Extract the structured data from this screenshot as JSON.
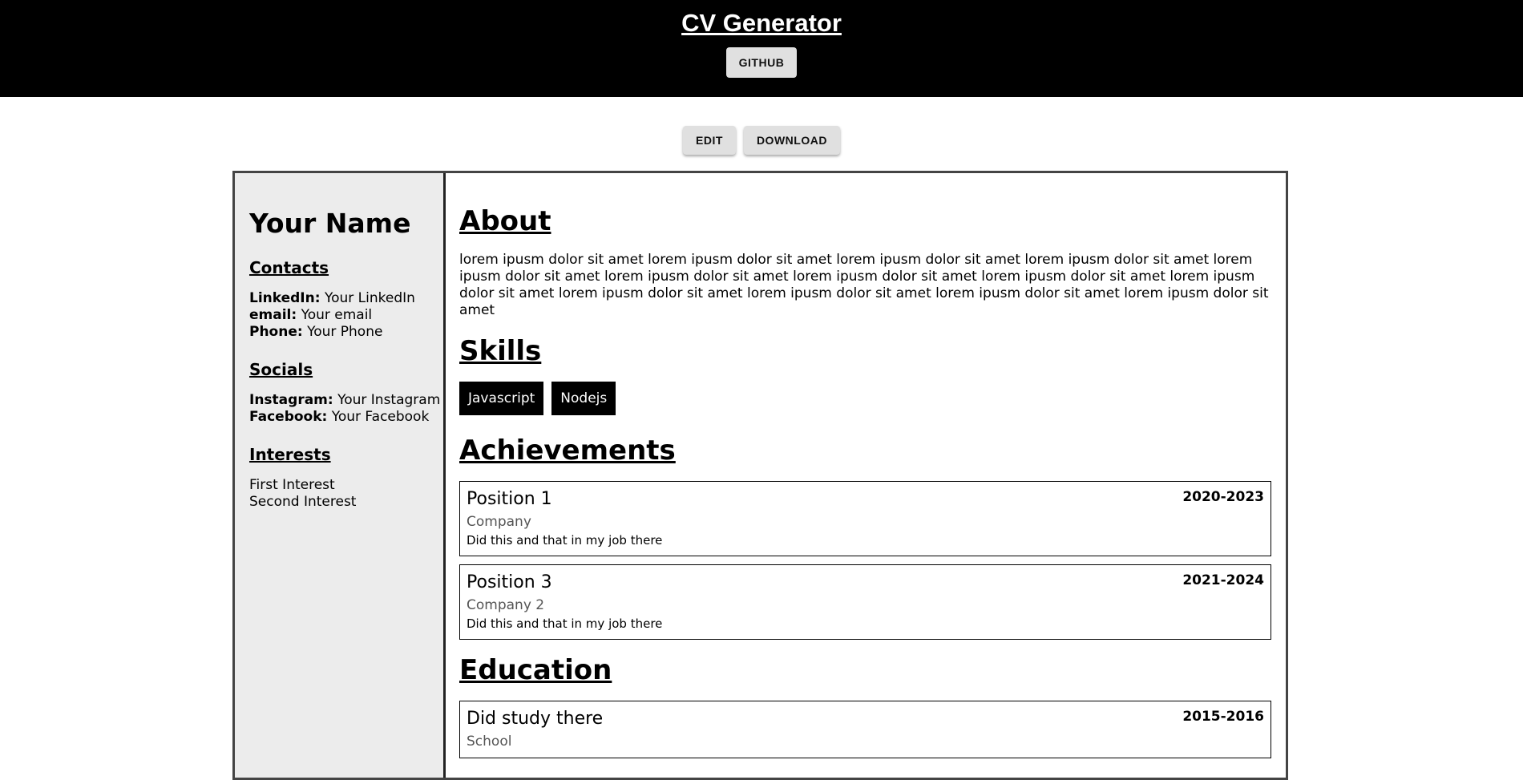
{
  "header": {
    "title": "CV Generator",
    "github_label": "GITHUB"
  },
  "actions": {
    "edit_label": "EDIT",
    "download_label": "DOWNLOAD"
  },
  "sidebar": {
    "name": "Your Name",
    "contacts_heading": "Contacts",
    "contacts": [
      {
        "label": "LinkedIn:",
        "value": "Your LinkedIn"
      },
      {
        "label": "email:",
        "value": "Your email"
      },
      {
        "label": "Phone:",
        "value": "Your Phone"
      }
    ],
    "socials_heading": "Socials",
    "socials": [
      {
        "label": "Instagram:",
        "value": "Your Instagram"
      },
      {
        "label": "Facebook:",
        "value": "Your Facebook"
      }
    ],
    "interests_heading": "Interests",
    "interests": [
      "First Interest",
      "Second Interest"
    ]
  },
  "main": {
    "about_heading": "About",
    "about_text": "lorem ipusm dolor sit amet lorem ipusm dolor sit amet lorem ipusm dolor sit amet lorem ipusm dolor sit amet lorem ipusm dolor sit amet lorem ipusm dolor sit amet lorem ipusm dolor sit amet lorem ipusm dolor sit amet lorem ipusm dolor sit amet lorem ipusm dolor sit amet lorem ipusm dolor sit amet lorem ipusm dolor sit amet lorem ipusm dolor sit amet",
    "skills_heading": "Skills",
    "skills": [
      "Javascript",
      "Nodejs"
    ],
    "achievements_heading": "Achievements",
    "achievements": [
      {
        "title": "Position 1",
        "date": "2020-2023",
        "company": "Company",
        "desc": "Did this and that in my job there"
      },
      {
        "title": "Position 3",
        "date": "2021-2024",
        "company": "Company 2",
        "desc": "Did this and that in my job there"
      }
    ],
    "education_heading": "Education",
    "education": [
      {
        "title": "Did study there",
        "date": "2015-2016",
        "school": "School"
      }
    ]
  }
}
